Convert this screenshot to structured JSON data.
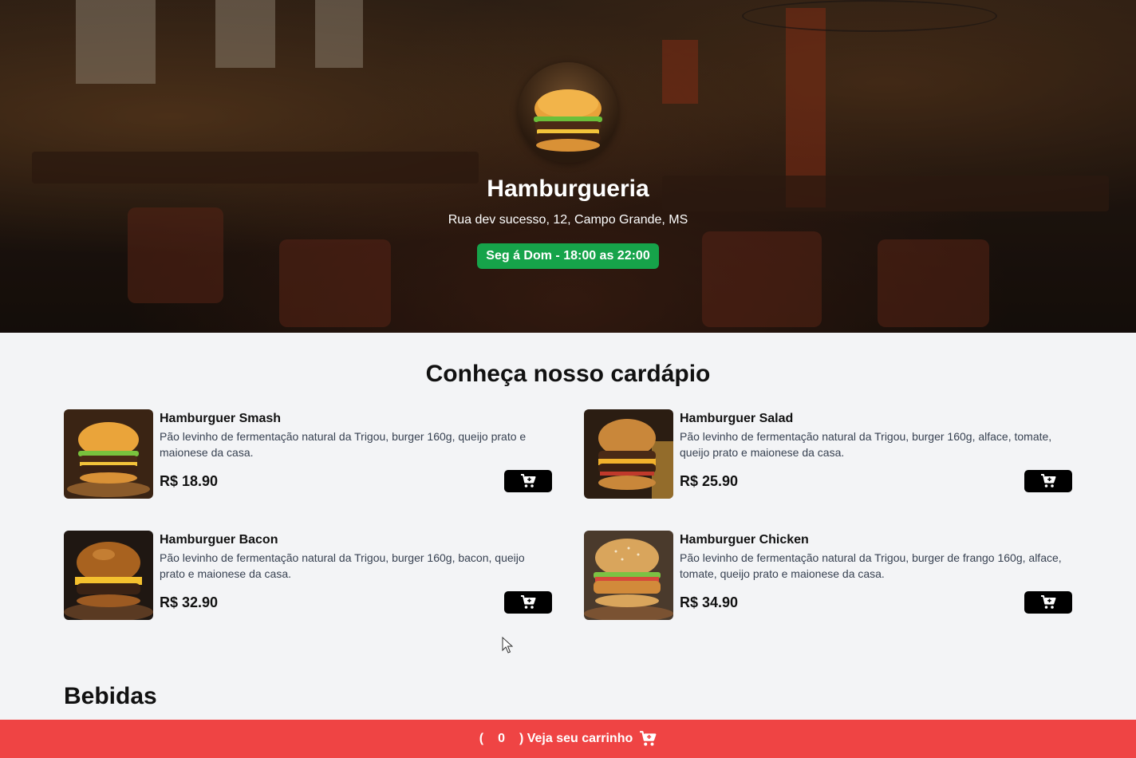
{
  "hero": {
    "title": "Hamburgueria",
    "address": "Rua dev sucesso, 12, Campo Grande, MS",
    "hours": "Seg á Dom - 18:00 as 22:00",
    "hours_color": "#16a34a"
  },
  "menu": {
    "title": "Conheça nosso cardápio",
    "items": [
      {
        "name": "Hamburguer Smash",
        "description": "Pão levinho de fermentação natural da Trigou, burger 160g, queijo prato e maionese da casa.",
        "price": "R$ 18.90",
        "button_icon": "cart-plus-icon"
      },
      {
        "name": "Hamburguer Salad",
        "description": "Pão levinho de fermentação natural da Trigou, burger 160g, alface, tomate, queijo prato e maionese da casa.",
        "price": "R$ 25.90",
        "button_icon": "cart-plus-icon"
      },
      {
        "name": "Hamburguer Bacon",
        "description": "Pão levinho de fermentação natural da Trigou, burger 160g, bacon, queijo prato e maionese da casa.",
        "price": "R$ 32.90",
        "button_icon": "cart-plus-icon"
      },
      {
        "name": "Hamburguer Chicken",
        "description": "Pão levinho de fermentação natural da Trigou, burger de frango 160g, alface, tomate, queijo prato e maionese da casa.",
        "price": "R$ 34.90",
        "button_icon": "cart-plus-icon"
      }
    ]
  },
  "drinks": {
    "title": "Bebidas"
  },
  "cart_bar": {
    "open_paren": "(",
    "count": "0",
    "label": ") Veja seu carrinho",
    "icon": "cart-icon",
    "color": "#ef4444"
  }
}
